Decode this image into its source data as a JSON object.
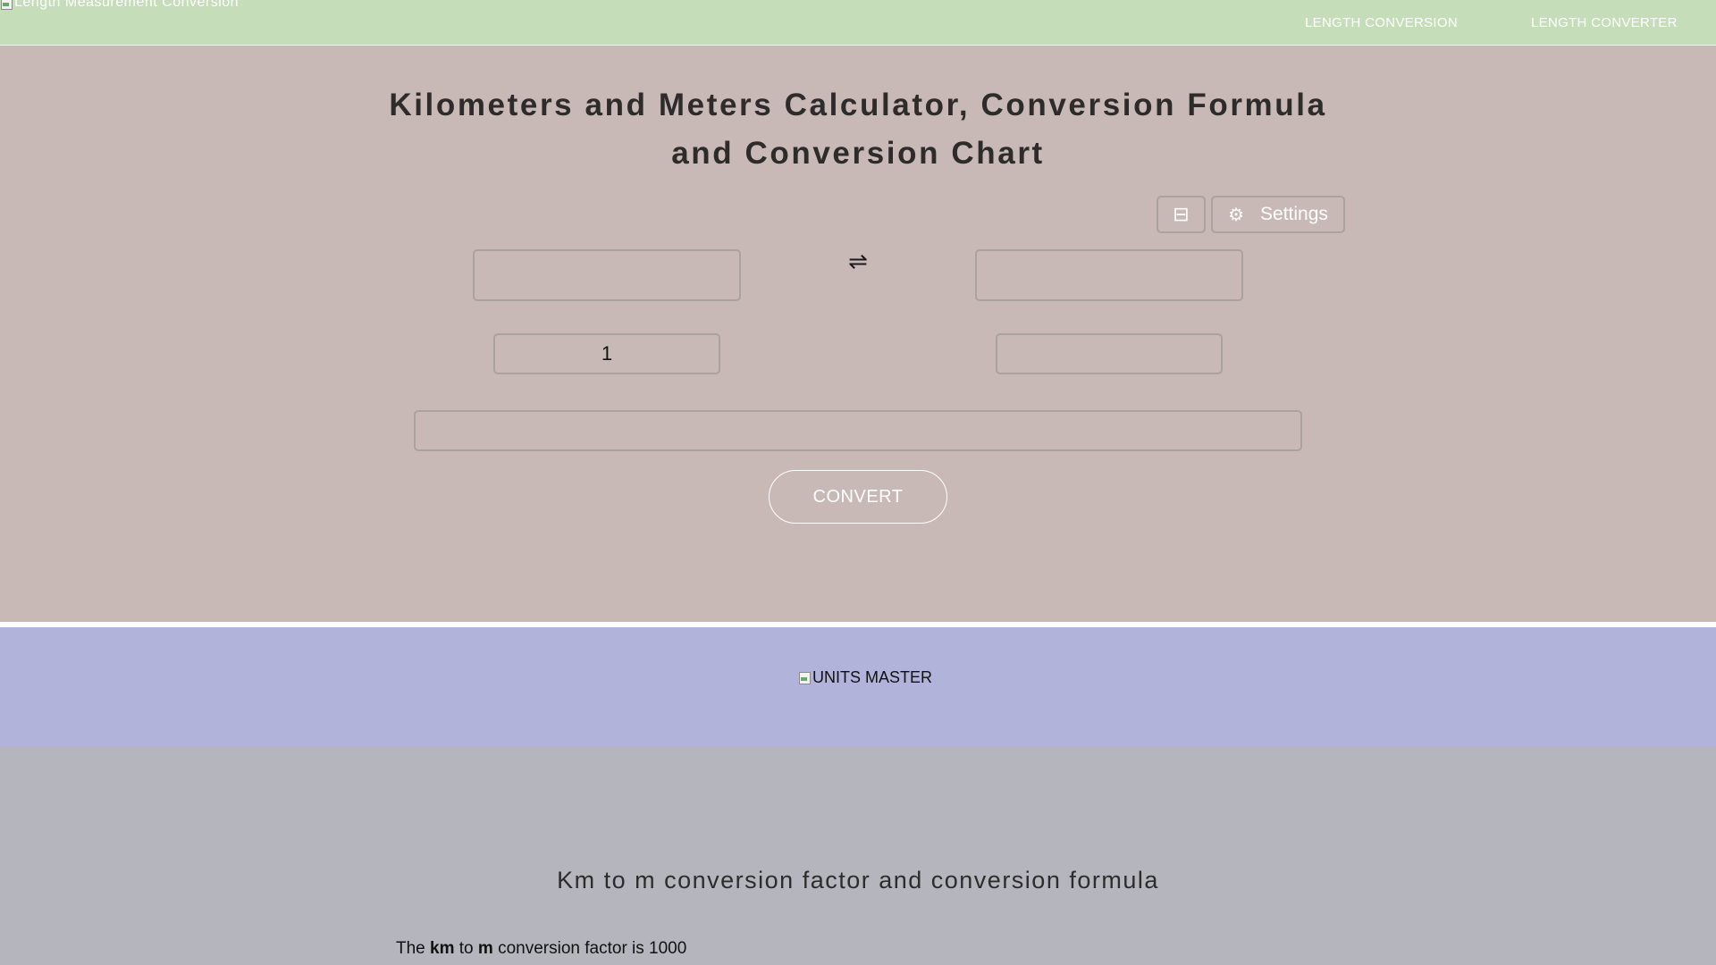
{
  "header": {
    "logo_alt": "Length Measurement Conversion",
    "nav": [
      {
        "label": "LENGTH CONVERSION"
      },
      {
        "label": "LENGTH CONVERTER"
      }
    ]
  },
  "calculator": {
    "title": "Kilometers and Meters Calculator, Conversion Formula and Conversion Chart",
    "layout_icon": "⊟",
    "settings_icon": "⚙",
    "settings_label": "Settings",
    "swap_icon": "⇌",
    "from_value": "1",
    "to_value": "",
    "convert_label": "CONVERT"
  },
  "brand": {
    "logo_alt": "UNITS MASTER"
  },
  "content": {
    "heading": "Km to m conversion factor and conversion formula",
    "factor_prefix": "The ",
    "factor_from": "km",
    "factor_mid": " to ",
    "factor_to": "m",
    "factor_suffix": " conversion factor is 1000"
  },
  "colors": {
    "nav_bg": "#c5ddb9",
    "calculator_bg": "#c8b9b6",
    "brand_bg": "#b2b3db",
    "content_bg": "#b5b5bd"
  }
}
